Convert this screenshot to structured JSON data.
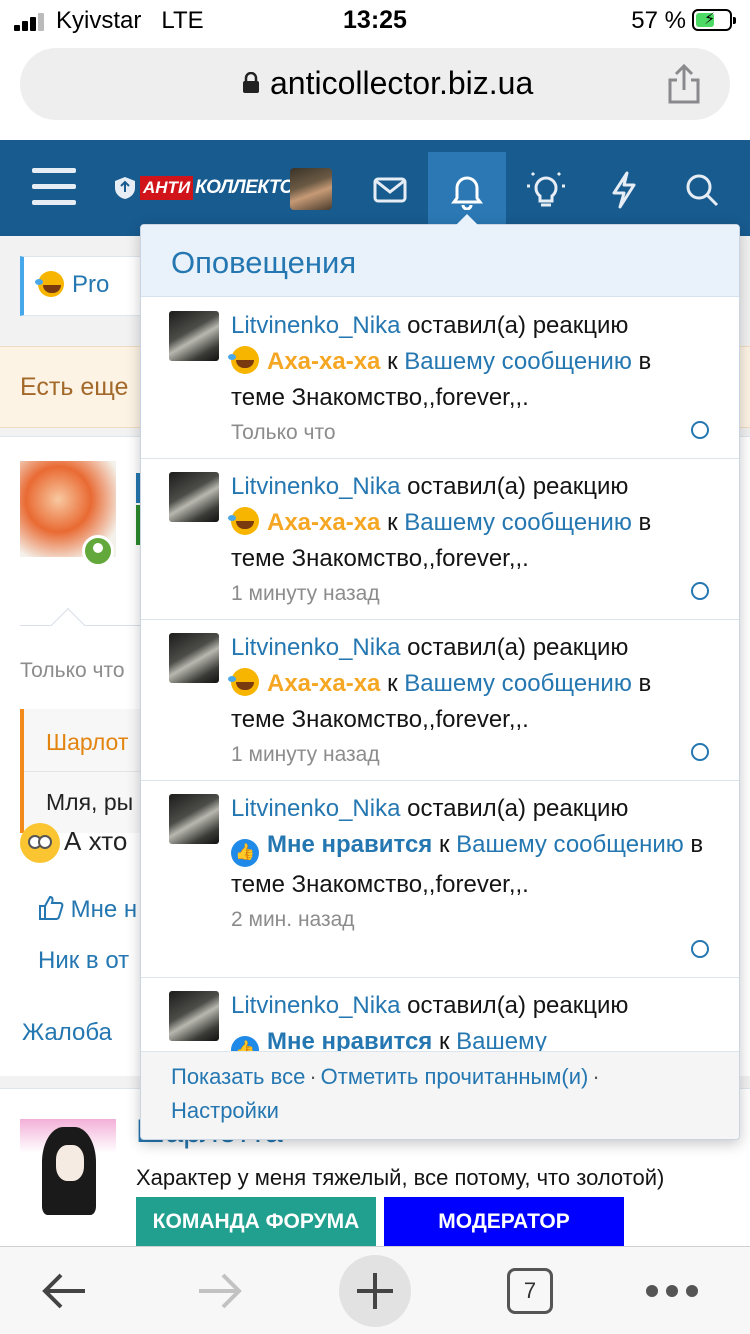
{
  "status_bar": {
    "carrier": "Kyivstar",
    "network": "LTE",
    "time": "13:25",
    "battery": "57 %",
    "battery_level": 0.57
  },
  "address_bar": {
    "url": "anticollector.biz.ua"
  },
  "header": {
    "logo_red": "АНТИ",
    "logo_white": "КОЛЛЕКТОР",
    "icons": [
      "menu-icon",
      "user-avatar",
      "mail-icon",
      "bell-icon",
      "lightbulb-icon",
      "lightning-icon",
      "search-icon"
    ]
  },
  "background": {
    "thread_chip": "Pro",
    "notice": "Есть еще",
    "post_time": "Только что",
    "quote_author": "Шарлот",
    "quote_text": "Мля, ры",
    "post_text": "А хто",
    "like_label": "Мне н",
    "nick_label": "Ник в от",
    "report_label": "Жалоба",
    "user2_name": "Шарлотта",
    "user2_tagline": "Характер у меня тяжелый, все потому, что золотой)",
    "badge_team": "КОМАНДА ФОРУМА",
    "badge_moderator": "МОДЕРАТОР",
    "colors": {
      "badge_team": "#21a08f",
      "badge_moderator": "#0000ff"
    }
  },
  "notifications": {
    "title": "Оповещения",
    "items": [
      {
        "user": "Litvinenko_Nika",
        "action": "оставил(а) реакцию",
        "reaction": "Аха-ха-ха",
        "reaction_type": "laugh",
        "to": "к",
        "link": "Вашему сообщению",
        "in_thread_prefix": "в теме",
        "thread": "Знакомство,,forever,,.",
        "time": "Только что"
      },
      {
        "user": "Litvinenko_Nika",
        "action": "оставил(а) реакцию",
        "reaction": "Аха-ха-ха",
        "reaction_type": "laugh",
        "to": "к",
        "link": "Вашему сообщению",
        "in_thread_prefix": "в теме",
        "thread": "Знакомство,,forever,,.",
        "time": "1 минуту назад"
      },
      {
        "user": "Litvinenko_Nika",
        "action": "оставил(а) реакцию",
        "reaction": "Аха-ха-ха",
        "reaction_type": "laugh",
        "to": "к",
        "link": "Вашему сообщению",
        "in_thread_prefix": "в теме",
        "thread": "Знакомство,,forever,,.",
        "time": "1 минуту назад"
      },
      {
        "user": "Litvinenko_Nika",
        "action": "оставил(а) реакцию",
        "reaction": "Мне нравится",
        "reaction_type": "like",
        "to": "к",
        "link": "Вашему сообщению",
        "in_thread_prefix": "в теме",
        "thread": "Знакомство,,forever,,.",
        "time": "2 мин. назад"
      },
      {
        "user": "Litvinenko_Nika",
        "action": "оставил(а) реакцию",
        "reaction": "Мне нравится",
        "reaction_type": "like",
        "to": "к",
        "link": "Вашему",
        "in_thread_prefix": "",
        "thread": "",
        "time": ""
      }
    ],
    "footer": {
      "show_all": "Показать все",
      "mark_read": "Отметить прочитанным(и)",
      "settings": "Настройки",
      "separator": "·"
    }
  },
  "toolbar": {
    "tabs_count": "7",
    "icons": [
      "back-arrow-icon",
      "forward-arrow-icon",
      "new-tab-plus-icon",
      "tabs-icon",
      "more-dots-icon"
    ]
  },
  "colors": {
    "header_bg": "#185b8f",
    "bell_tab_bg": "#2b78b4",
    "link": "#2577b1",
    "laugh_reaction": "#f5a623"
  }
}
